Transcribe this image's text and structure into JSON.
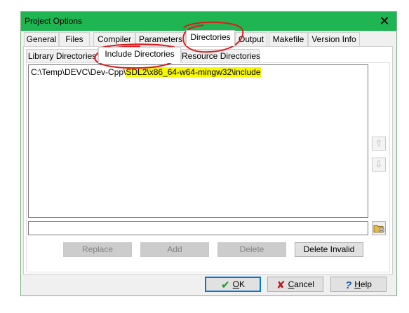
{
  "window": {
    "title": "Project Options",
    "close_glyph": "✕"
  },
  "tabs": [
    {
      "label": "General"
    },
    {
      "label": "Files"
    },
    {
      "label": "Compiler"
    },
    {
      "label": "Parameters"
    },
    {
      "label": "Directories",
      "active": true
    },
    {
      "label": "Output"
    },
    {
      "label": "Makefile"
    },
    {
      "label": "Version Info"
    }
  ],
  "subtabs": [
    {
      "label": "Library Directories"
    },
    {
      "label": "Include Directories",
      "active": true
    },
    {
      "label": "Resource Directories"
    }
  ],
  "directories": {
    "items": [
      {
        "path_prefix": "C:\\Temp\\DEVC\\Dev-Cpp\\",
        "path_highlight": "SDL2\\x86_64-w64-mingw32\\include"
      }
    ],
    "path_input_value": "",
    "move_up_glyph": "⇧",
    "move_down_glyph": "⇩"
  },
  "actions": {
    "replace": "Replace",
    "add": "Add",
    "delete": "Delete",
    "delete_invalid": "Delete Invalid"
  },
  "dialog_buttons": {
    "ok": {
      "glyph": "✔",
      "label_prefix": "",
      "accel": "O",
      "label_rest": "K"
    },
    "cancel": {
      "glyph": "✘",
      "label_prefix": "",
      "accel": "C",
      "label_rest": "ancel"
    },
    "help": {
      "glyph": "?",
      "label_prefix": "",
      "accel": "H",
      "label_rest": "elp"
    }
  },
  "colors": {
    "titlebar": "#1fb552",
    "highlight": "#f7f700",
    "annotation": "#e0191c",
    "ok_check": "#1a9a2a",
    "cancel_x": "#c01818",
    "help_q": "#1a5fb4"
  }
}
